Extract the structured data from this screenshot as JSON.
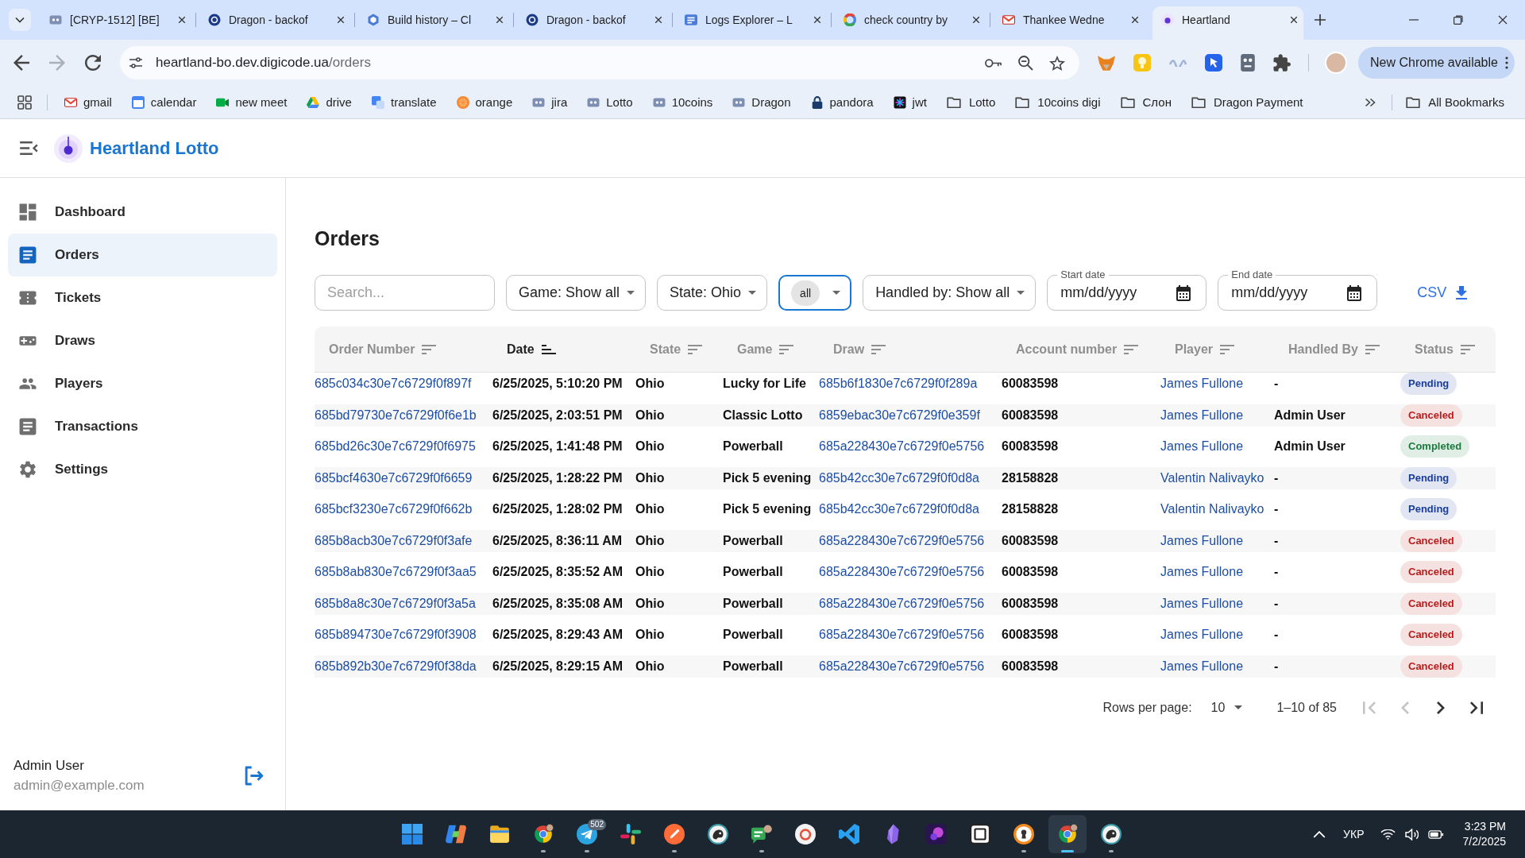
{
  "browser": {
    "tabs": [
      {
        "title": "[CRYP-1512] [BE]",
        "selected": false
      },
      {
        "title": "Dragon - backof",
        "selected": false
      },
      {
        "title": "Build history – Cl",
        "selected": false
      },
      {
        "title": "Dragon - backof",
        "selected": false
      },
      {
        "title": "Logs Explorer – L",
        "selected": false
      },
      {
        "title": "check country by",
        "selected": false
      },
      {
        "title": "Thankee Wedne",
        "selected": false
      },
      {
        "title": "Heartland",
        "selected": true
      }
    ],
    "navigation": [
      {
        "kind": "back",
        "disabled": false
      },
      {
        "kind": "forward",
        "disabled": true
      },
      {
        "kind": "reload",
        "disabled": false
      }
    ],
    "address": {
      "host": "heartland-bo.dev.digicode.ua",
      "path": "/orders"
    },
    "update_button": "New Chrome available",
    "bookmarks": [
      {
        "label": "gmail",
        "kind": "link"
      },
      {
        "label": "calendar",
        "kind": "link"
      },
      {
        "label": "new meet",
        "kind": "link"
      },
      {
        "label": "drive",
        "kind": "link"
      },
      {
        "label": "translate",
        "kind": "link"
      },
      {
        "label": "orange",
        "kind": "link"
      },
      {
        "label": "jira",
        "kind": "link"
      },
      {
        "label": "Lotto",
        "kind": "link"
      },
      {
        "label": "10coins",
        "kind": "link"
      },
      {
        "label": "Dragon",
        "kind": "link"
      },
      {
        "label": "pandora",
        "kind": "link"
      },
      {
        "label": "jwt",
        "kind": "link"
      },
      {
        "label": "Lotto",
        "kind": "folder"
      },
      {
        "label": "10coins digi",
        "kind": "folder"
      },
      {
        "label": "Слон",
        "kind": "folder"
      },
      {
        "label": "Dragon Payment",
        "kind": "folder"
      }
    ],
    "all_bookmarks": "All Bookmarks"
  },
  "app": {
    "title": "Heartland Lotto"
  },
  "sidebar": {
    "items": [
      {
        "label": "Dashboard",
        "selected": false
      },
      {
        "label": "Orders",
        "selected": true
      },
      {
        "label": "Tickets",
        "selected": false
      },
      {
        "label": "Draws",
        "selected": false
      },
      {
        "label": "Players",
        "selected": false
      },
      {
        "label": "Transactions",
        "selected": false
      },
      {
        "label": "Settings",
        "selected": false
      }
    ],
    "user": {
      "name": "Admin User",
      "email": "admin@example.com"
    }
  },
  "page": {
    "title": "Orders",
    "filters": [
      {
        "kind": "search",
        "placeholder": "Search...",
        "focused": false
      },
      {
        "kind": "select",
        "label": "Game: Show all",
        "focused": false
      },
      {
        "kind": "select",
        "label": "State: Ohio",
        "focused": false
      },
      {
        "kind": "chip-select",
        "label": "all",
        "focused": true
      },
      {
        "kind": "select",
        "label": "Handled by: Show all",
        "focused": false
      },
      {
        "kind": "date",
        "label": "Start date",
        "placeholder": "mm/dd/yyyy",
        "focused": false
      },
      {
        "kind": "date",
        "label": "End date",
        "placeholder": "mm/dd/yyyy",
        "focused": false
      }
    ],
    "export_button": "CSV",
    "table": {
      "columns": [
        {
          "label": "Order Number",
          "sorted": false
        },
        {
          "label": "Date",
          "sorted": true
        },
        {
          "label": "State",
          "sorted": false
        },
        {
          "label": "Game",
          "sorted": false
        },
        {
          "label": "Draw",
          "sorted": false
        },
        {
          "label": "Account number",
          "sorted": false
        },
        {
          "label": "Player",
          "sorted": false
        },
        {
          "label": "Handled By",
          "sorted": false
        },
        {
          "label": "Status",
          "sorted": false
        }
      ],
      "rows": [
        {
          "order_number": "685c034c30e7c6729f0f897f",
          "date": "6/25/2025, 5:10:20 PM",
          "state": "Ohio",
          "game": "Lucky for Life",
          "draw": "685b6f1830e7c6729f0f289a",
          "account_number": "60083598",
          "player": "James Fullone",
          "handled_by": "-",
          "status": {
            "label": "Pending",
            "color": "#1a3d99"
          }
        },
        {
          "order_number": "685bd79730e7c6729f0f6e1b",
          "date": "6/25/2025, 2:03:51 PM",
          "state": "Ohio",
          "game": "Classic Lotto",
          "draw": "6859ebac30e7c6729f0e359f",
          "account_number": "60083598",
          "player": "James Fullone",
          "handled_by": "Admin User",
          "status": {
            "label": "Canceled",
            "color": "#b71c1c"
          }
        },
        {
          "order_number": "685bd26c30e7c6729f0f6975",
          "date": "6/25/2025, 1:41:48 PM",
          "state": "Ohio",
          "game": "Powerball",
          "draw": "685a228430e7c6729f0e5756",
          "account_number": "60083598",
          "player": "James Fullone",
          "handled_by": "Admin User",
          "status": {
            "label": "Completed",
            "color": "#1b7a3e"
          }
        },
        {
          "order_number": "685bcf4630e7c6729f0f6659",
          "date": "6/25/2025, 1:28:22 PM",
          "state": "Ohio",
          "game": "Pick 5 evening",
          "draw": "685b42cc30e7c6729f0f0d8a",
          "account_number": "28158828",
          "player": "Valentin Nalivayko",
          "handled_by": "-",
          "status": {
            "label": "Pending",
            "color": "#1a3d99"
          }
        },
        {
          "order_number": "685bcf3230e7c6729f0f662b",
          "date": "6/25/2025, 1:28:02 PM",
          "state": "Ohio",
          "game": "Pick 5 evening",
          "draw": "685b42cc30e7c6729f0f0d8a",
          "account_number": "28158828",
          "player": "Valentin Nalivayko",
          "handled_by": "-",
          "status": {
            "label": "Pending",
            "color": "#1a3d99"
          }
        },
        {
          "order_number": "685b8acb30e7c6729f0f3afe",
          "date": "6/25/2025, 8:36:11 AM",
          "state": "Ohio",
          "game": "Powerball",
          "draw": "685a228430e7c6729f0e5756",
          "account_number": "60083598",
          "player": "James Fullone",
          "handled_by": "-",
          "status": {
            "label": "Canceled",
            "color": "#b71c1c"
          }
        },
        {
          "order_number": "685b8ab830e7c6729f0f3aa5",
          "date": "6/25/2025, 8:35:52 AM",
          "state": "Ohio",
          "game": "Powerball",
          "draw": "685a228430e7c6729f0e5756",
          "account_number": "60083598",
          "player": "James Fullone",
          "handled_by": "-",
          "status": {
            "label": "Canceled",
            "color": "#b71c1c"
          }
        },
        {
          "order_number": "685b8a8c30e7c6729f0f3a5a",
          "date": "6/25/2025, 8:35:08 AM",
          "state": "Ohio",
          "game": "Powerball",
          "draw": "685a228430e7c6729f0e5756",
          "account_number": "60083598",
          "player": "James Fullone",
          "handled_by": "-",
          "status": {
            "label": "Canceled",
            "color": "#b71c1c"
          }
        },
        {
          "order_number": "685b894730e7c6729f0f3908",
          "date": "6/25/2025, 8:29:43 AM",
          "state": "Ohio",
          "game": "Powerball",
          "draw": "685a228430e7c6729f0e5756",
          "account_number": "60083598",
          "player": "James Fullone",
          "handled_by": "-",
          "status": {
            "label": "Canceled",
            "color": "#b71c1c"
          }
        },
        {
          "order_number": "685b892b30e7c6729f0f38da",
          "date": "6/25/2025, 8:29:15 AM",
          "state": "Ohio",
          "game": "Powerball",
          "draw": "685a228430e7c6729f0e5756",
          "account_number": "60083598",
          "player": "James Fullone",
          "handled_by": "-",
          "status": {
            "label": "Canceled",
            "color": "#b71c1c"
          }
        }
      ]
    },
    "pagination": {
      "rows_per_page_label": "Rows per page:",
      "rows_per_page": "10",
      "range": "1–10 of 85",
      "buttons": [
        {
          "kind": "first",
          "disabled": true
        },
        {
          "kind": "previous",
          "disabled": true
        },
        {
          "kind": "next",
          "disabled": false
        },
        {
          "kind": "last",
          "disabled": false
        }
      ]
    }
  },
  "taskbar": {
    "apps": [
      {
        "running": false,
        "active": false
      },
      {
        "running": false,
        "active": false
      },
      {
        "running": false,
        "active": false
      },
      {
        "running": true,
        "active": false
      },
      {
        "running": true,
        "active": false,
        "badge": "502"
      },
      {
        "running": false,
        "active": false
      },
      {
        "running": true,
        "active": false
      },
      {
        "running": false,
        "active": false
      },
      {
        "running": true,
        "active": false
      },
      {
        "running": false,
        "active": false
      },
      {
        "running": false,
        "active": false
      },
      {
        "running": false,
        "active": false
      },
      {
        "running": false,
        "active": false
      },
      {
        "running": false,
        "active": false
      },
      {
        "running": true,
        "active": false
      },
      {
        "running": true,
        "active": true
      },
      {
        "running": true,
        "active": false
      }
    ],
    "language": "УКР",
    "time": "3:23 PM",
    "date": "7/2/2025"
  }
}
